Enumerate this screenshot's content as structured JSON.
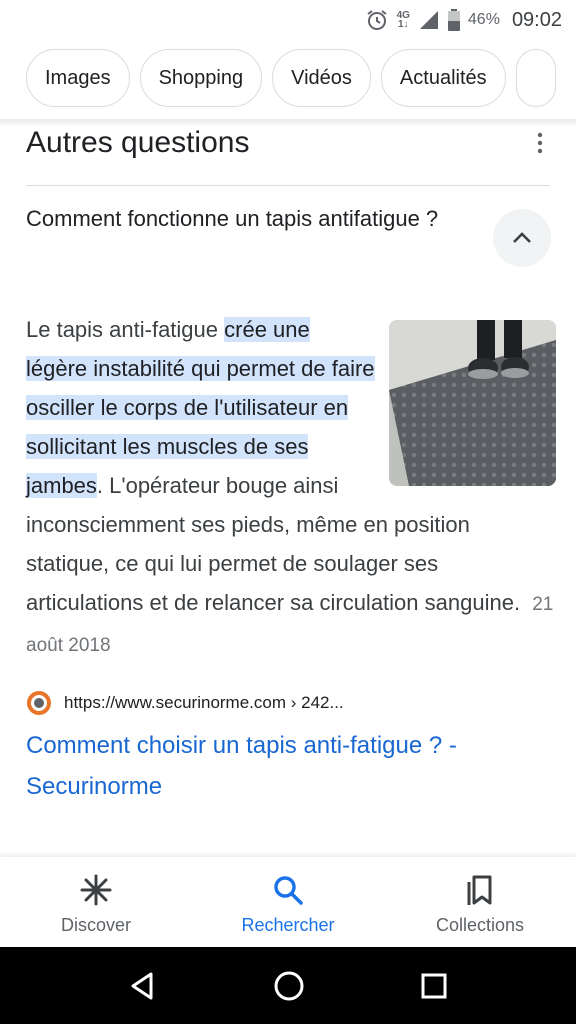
{
  "status_bar": {
    "network_top": "4G",
    "network_bottom": "1↓",
    "battery_percent": "46%",
    "time": "09:02"
  },
  "chips": [
    {
      "label": "Images"
    },
    {
      "label": "Shopping"
    },
    {
      "label": "Vidéos"
    },
    {
      "label": "Actualités"
    }
  ],
  "section": {
    "title": "Autres questions"
  },
  "question": {
    "text": "Comment fonctionne un tapis antifatigue ?"
  },
  "answer": {
    "text_before": "Le tapis anti-fatigue ",
    "highlight": "crée une légère instabilité qui permet de faire osciller le corps de l'utilisateur en sollicitant les muscles de ses jambes",
    "text_after": ". L'opérateur bouge ainsi inconsciemment ses pieds, même en position statique, ce qui lui permet de soulager ses articulations et de relancer sa circulation sanguine.",
    "date": "21 août 2018"
  },
  "source": {
    "url": "https://www.securinorme.com › 242...",
    "link_title": "Comment choisir un tapis anti-fatigue ? - Securinorme"
  },
  "bottom_nav": [
    {
      "label": "Discover",
      "icon": "asterisk-icon",
      "active": false
    },
    {
      "label": "Rechercher",
      "icon": "search-icon",
      "active": true
    },
    {
      "label": "Collections",
      "icon": "bookmarks-icon",
      "active": false
    }
  ],
  "colors": {
    "link": "#1967d2",
    "highlight_bg": "#d2e3fc",
    "active_nav": "#1a73e8"
  }
}
